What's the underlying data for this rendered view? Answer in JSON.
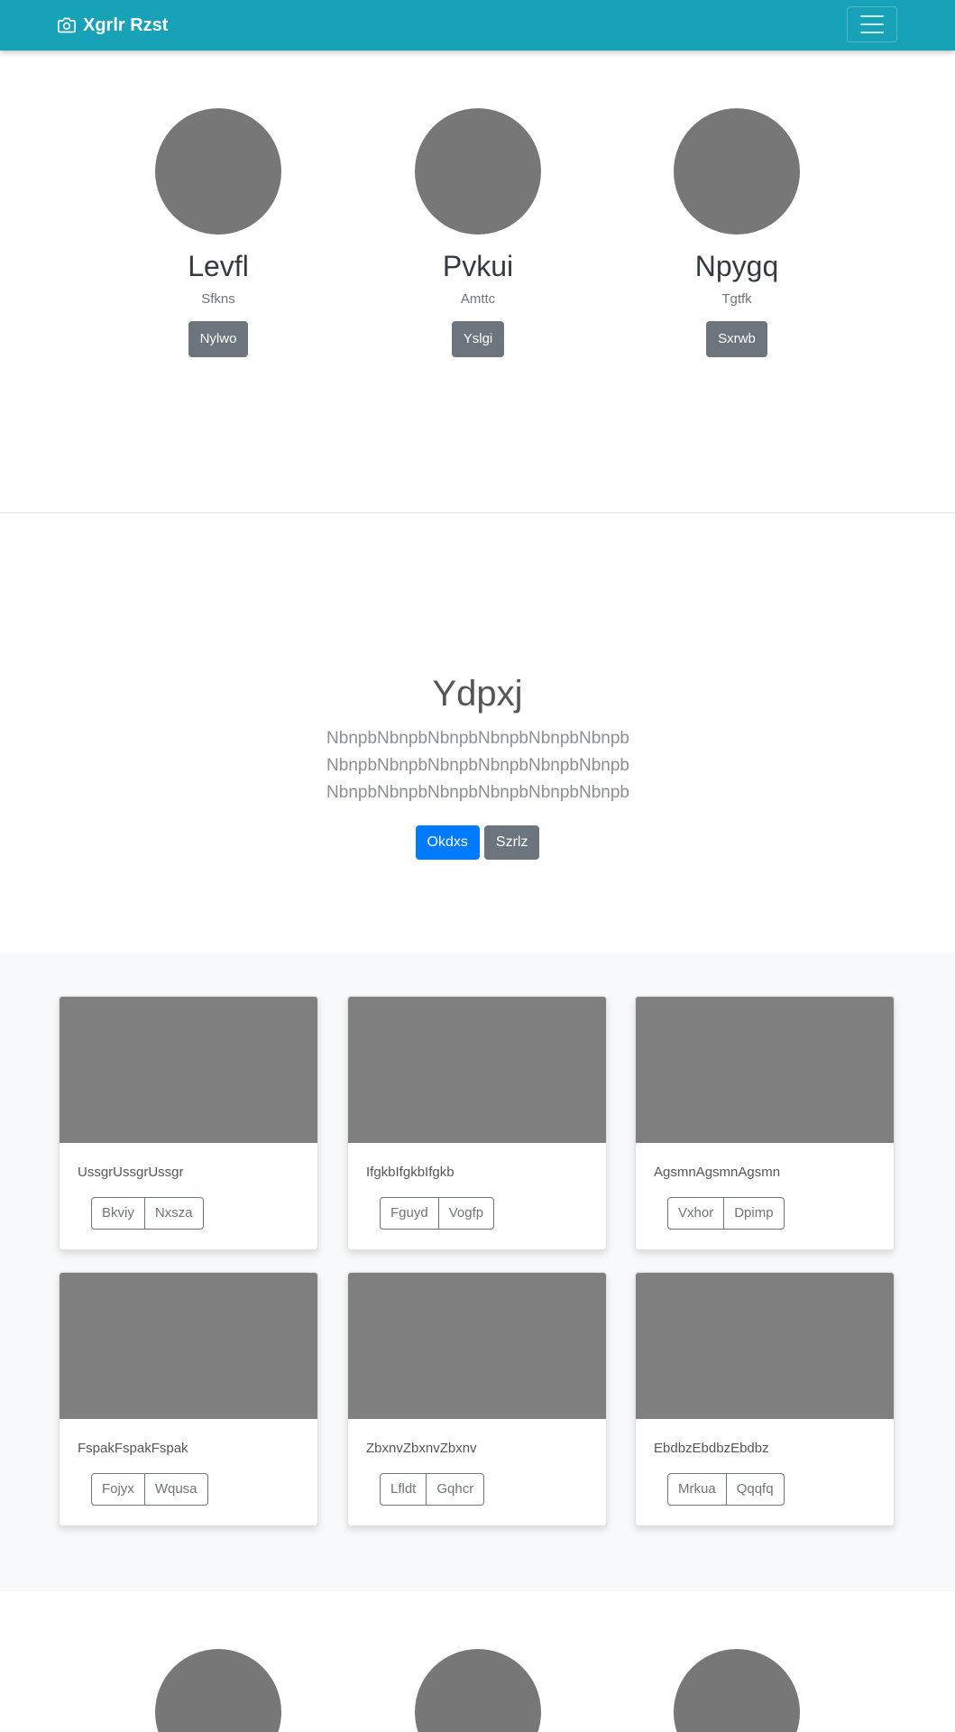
{
  "navbar": {
    "brand": "Xgrlr Rzst",
    "brand_icon": "camera-icon",
    "toggler_icon": "hamburger-menu-icon"
  },
  "team": {
    "members": [
      {
        "name": "Levfl",
        "role": "Sfkns",
        "button": "Nylwo"
      },
      {
        "name": "Pvkui",
        "role": "Amttc",
        "button": "Yslgi"
      },
      {
        "name": "Npygq",
        "role": "Tgtfk",
        "button": "Sxrwb"
      }
    ]
  },
  "hero": {
    "title": "Ydpxj",
    "lead": "NbnpbNbnpbNbnpbNbnpbNbnpbNbnpb NbnpbNbnpbNbnpbNbnpbNbnpbNbnpb NbnpbNbnpbNbnpbNbnpbNbnpbNbnpb",
    "primary_button": "Okdxs",
    "secondary_button": "Szrlz"
  },
  "album": {
    "cards": [
      {
        "text": "UssgrUssgrUssgr",
        "btn1": "Bkviy",
        "btn2": "Nxsza"
      },
      {
        "text": "IfgkbIfgkbIfgkb",
        "btn1": "Fguyd",
        "btn2": "Vogfp"
      },
      {
        "text": "AgsmnAgsmnAgsmn",
        "btn1": "Vxhor",
        "btn2": "Dpimp"
      },
      {
        "text": "FspakFspakFspak",
        "btn1": "Fojyx",
        "btn2": "Wqusa"
      },
      {
        "text": "ZbxnvZbxnvZbxnv",
        "btn1": "Lfldt",
        "btn2": "Gqhcr"
      },
      {
        "text": "EbdbzEbdbzEbdbz",
        "btn1": "Mrkua",
        "btn2": "Qqqfq"
      }
    ]
  },
  "colors": {
    "navbar": "#17a2b8",
    "primary": "#007bff",
    "secondary": "#6c757d",
    "placeholder": "#777777",
    "album_bg": "#f8f9fa"
  }
}
